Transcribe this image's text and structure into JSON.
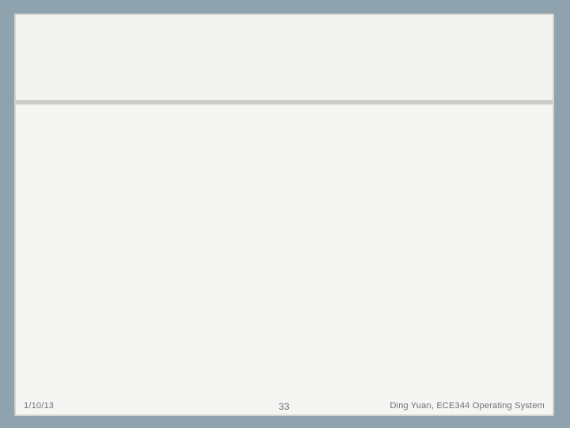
{
  "slide": {
    "footer": {
      "date": "1/10/13",
      "page_number": "33",
      "author": "Ding Yuan, ECE344 Operating System"
    }
  },
  "colors": {
    "background": "#8fa3ae",
    "card": "#f4f4f2",
    "rule": "#cbcdc9",
    "footer_text": "#6f6f6f"
  }
}
